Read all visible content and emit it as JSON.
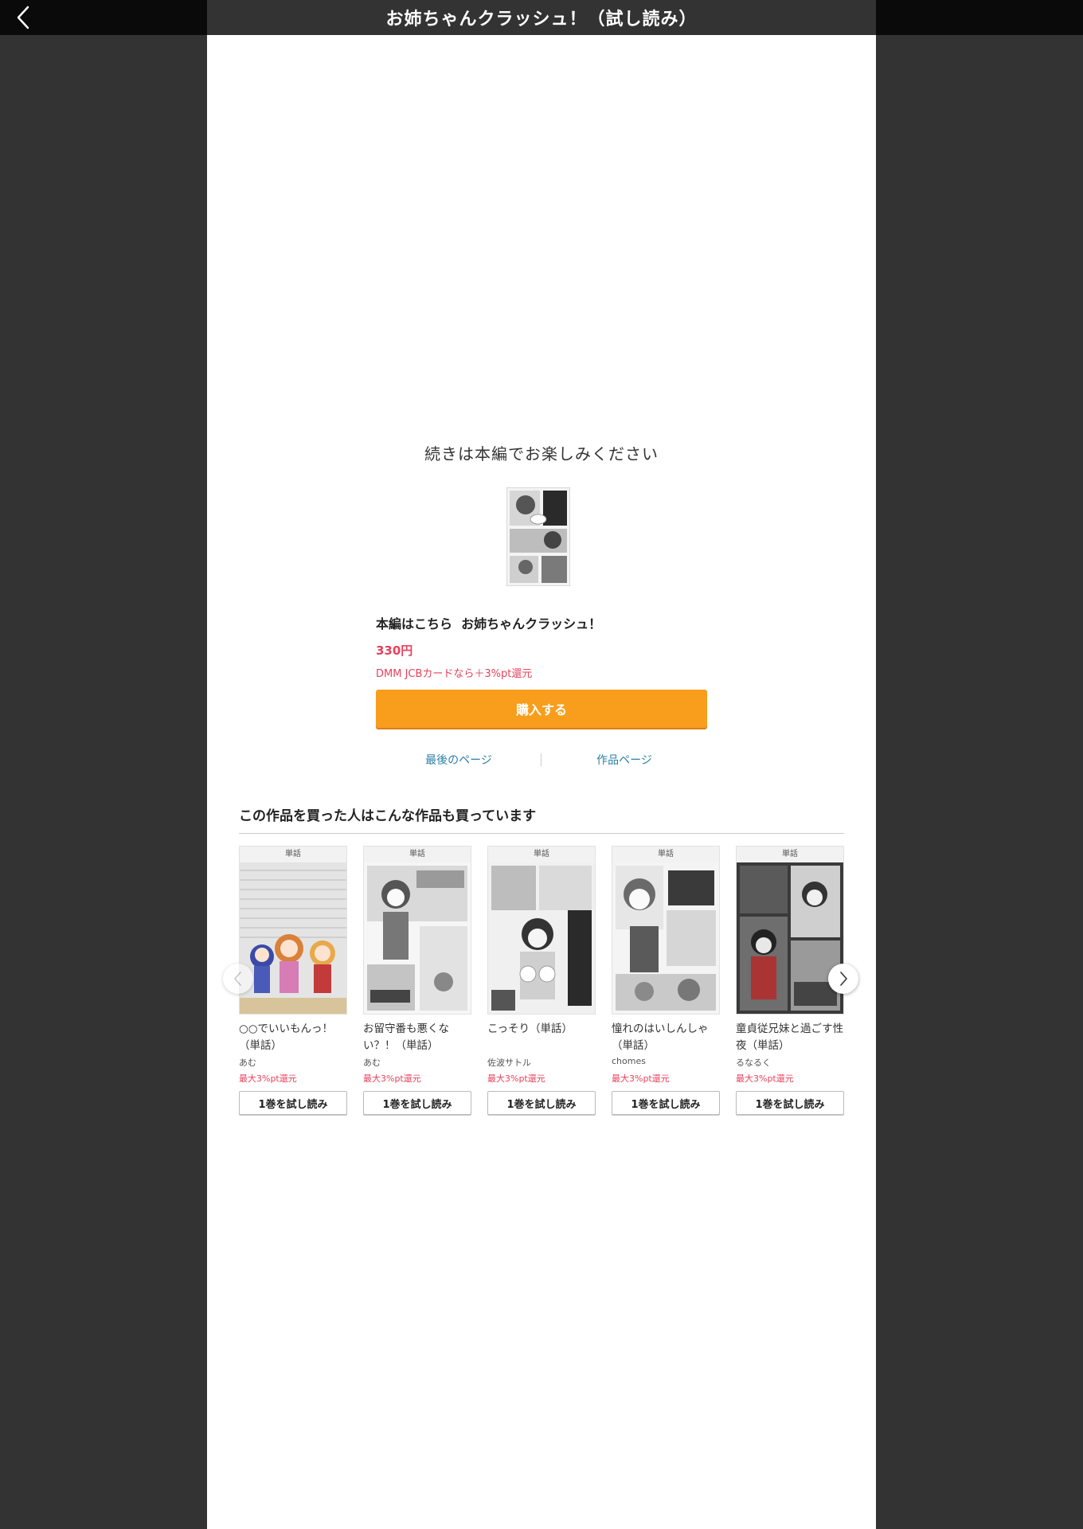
{
  "header": {
    "back_icon": "chevron-left-icon",
    "title": "お姉ちゃんクラッシュ！（試し読み）"
  },
  "main": {
    "continue_message": "続きは本編でお楽しみください",
    "product": {
      "label": "本編はこちら",
      "title": "お姉ちゃんクラッシュ！",
      "price": "330円",
      "card_note": "DMM JCBカードなら＋3%pt還元",
      "buy_label": "購入する"
    },
    "links": {
      "last_page": "最後のページ",
      "work_page": "作品ページ"
    }
  },
  "recommend": {
    "title": "この作品を買った人はこんな作品も買っています",
    "prev_icon": "chevron-left-icon",
    "next_icon": "chevron-right-icon",
    "items": [
      {
        "badge": "単話",
        "title": "○○でいいもんっ！（単話）",
        "author": "あむ",
        "point": "最大3%pt還元",
        "trial": "1巻を試し読み"
      },
      {
        "badge": "単話",
        "title": "お留守番も悪くない？！（単話）",
        "author": "あむ",
        "point": "最大3%pt還元",
        "trial": "1巻を試し読み"
      },
      {
        "badge": "単話",
        "title": "こっそり（単話）",
        "author": "佐波サトル",
        "point": "最大3%pt還元",
        "trial": "1巻を試し読み"
      },
      {
        "badge": "単話",
        "title": "憧れのはいしんしゃ（単話）",
        "author": "chomes",
        "point": "最大3%pt還元",
        "trial": "1巻を試し読み"
      },
      {
        "badge": "単話",
        "title": "童貞従兄妹と過ごす性夜（単話）",
        "author": "るなるく",
        "point": "最大3%pt還元",
        "trial": "1巻を試し読み"
      }
    ]
  },
  "colors": {
    "accent_orange": "#f99d1c",
    "price_red": "#e8415b",
    "link_blue": "#2b7fa8",
    "backdrop": "#333333"
  }
}
